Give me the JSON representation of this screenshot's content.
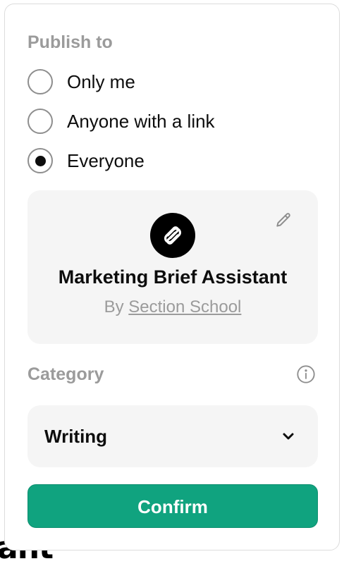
{
  "background_fragment": "ant",
  "publish": {
    "title": "Publish to",
    "options": [
      {
        "label": "Only me",
        "checked": false
      },
      {
        "label": "Anyone with a link",
        "checked": false
      },
      {
        "label": "Everyone",
        "checked": true
      }
    ]
  },
  "gpt": {
    "logo_icon": "paperclip-icon",
    "name": "Marketing Brief Assistant",
    "by_prefix": "By",
    "author": "Section School",
    "edit_icon": "pencil-icon"
  },
  "category": {
    "title": "Category",
    "info_icon": "info-icon",
    "selected": "Writing",
    "dropdown_icon": "chevron-down-icon"
  },
  "confirm_label": "Confirm",
  "colors": {
    "accent": "#10a37f",
    "muted_text": "#9b9b9b",
    "card_bg": "#f5f5f5"
  }
}
